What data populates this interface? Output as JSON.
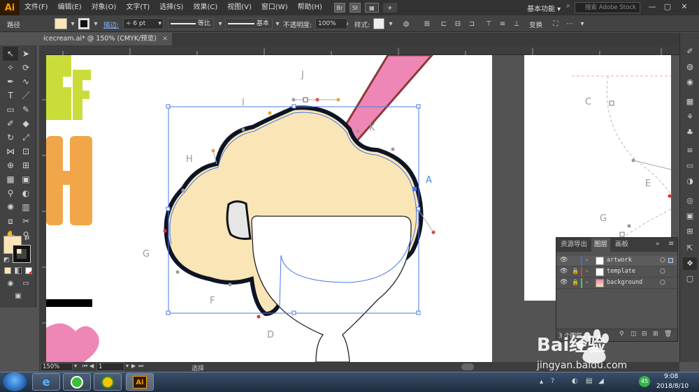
{
  "app": {
    "logo": "Ai",
    "menus": [
      "文件(F)",
      "编辑(E)",
      "对象(O)",
      "文字(T)",
      "选择(S)",
      "效果(C)",
      "视图(V)",
      "窗口(W)",
      "帮助(H)"
    ],
    "badges": [
      "Br",
      "St"
    ],
    "workspace": "基本功能",
    "search_placeholder": "搜索 Adobe Stock"
  },
  "controlbar": {
    "selection_type": "路径",
    "stroke_label": "描边:",
    "stroke_weight": "6 pt",
    "stroke_profile": "等比",
    "brush_def": "基本",
    "opacity_label": "不透明度:",
    "opacity_value": "100%",
    "style_label": "样式:",
    "transform_label": "变换"
  },
  "document": {
    "tab_title": "icecream.ai* @ 150% (CMYK/预览)",
    "close": "×"
  },
  "canvas": {
    "point_labels": [
      "A",
      "C",
      "D",
      "E",
      "F",
      "G",
      "G",
      "H",
      "I",
      "J",
      "K"
    ],
    "letters_art": [
      "F",
      "H"
    ]
  },
  "layers_panel": {
    "tabs": [
      "资源导出",
      "图层",
      "画板"
    ],
    "active_tab": "图层",
    "layers": [
      {
        "name": "artwork",
        "color": "#3b6fe0"
      },
      {
        "name": "template",
        "color": "#e03b3b"
      },
      {
        "name": "background",
        "color": "#3bd05a"
      }
    ],
    "footer_count": "3 个图层"
  },
  "statusbar": {
    "zoom": "150%",
    "artboard": "1",
    "mode": "选择"
  },
  "taskbar": {
    "time": "9:08",
    "date": "2018/8/10",
    "ai_label": "Ai",
    "tray_badge": "45"
  },
  "watermark": {
    "brand": "Bai经验",
    "url": "jingyan.baidu.com"
  },
  "colors": {
    "fill": "#fae5b6",
    "scoop": "#fae5b6",
    "selection": "#4a78e6",
    "pink": "#ee87b5",
    "lime": "#c9dc3a",
    "orange": "#f2a64a"
  }
}
